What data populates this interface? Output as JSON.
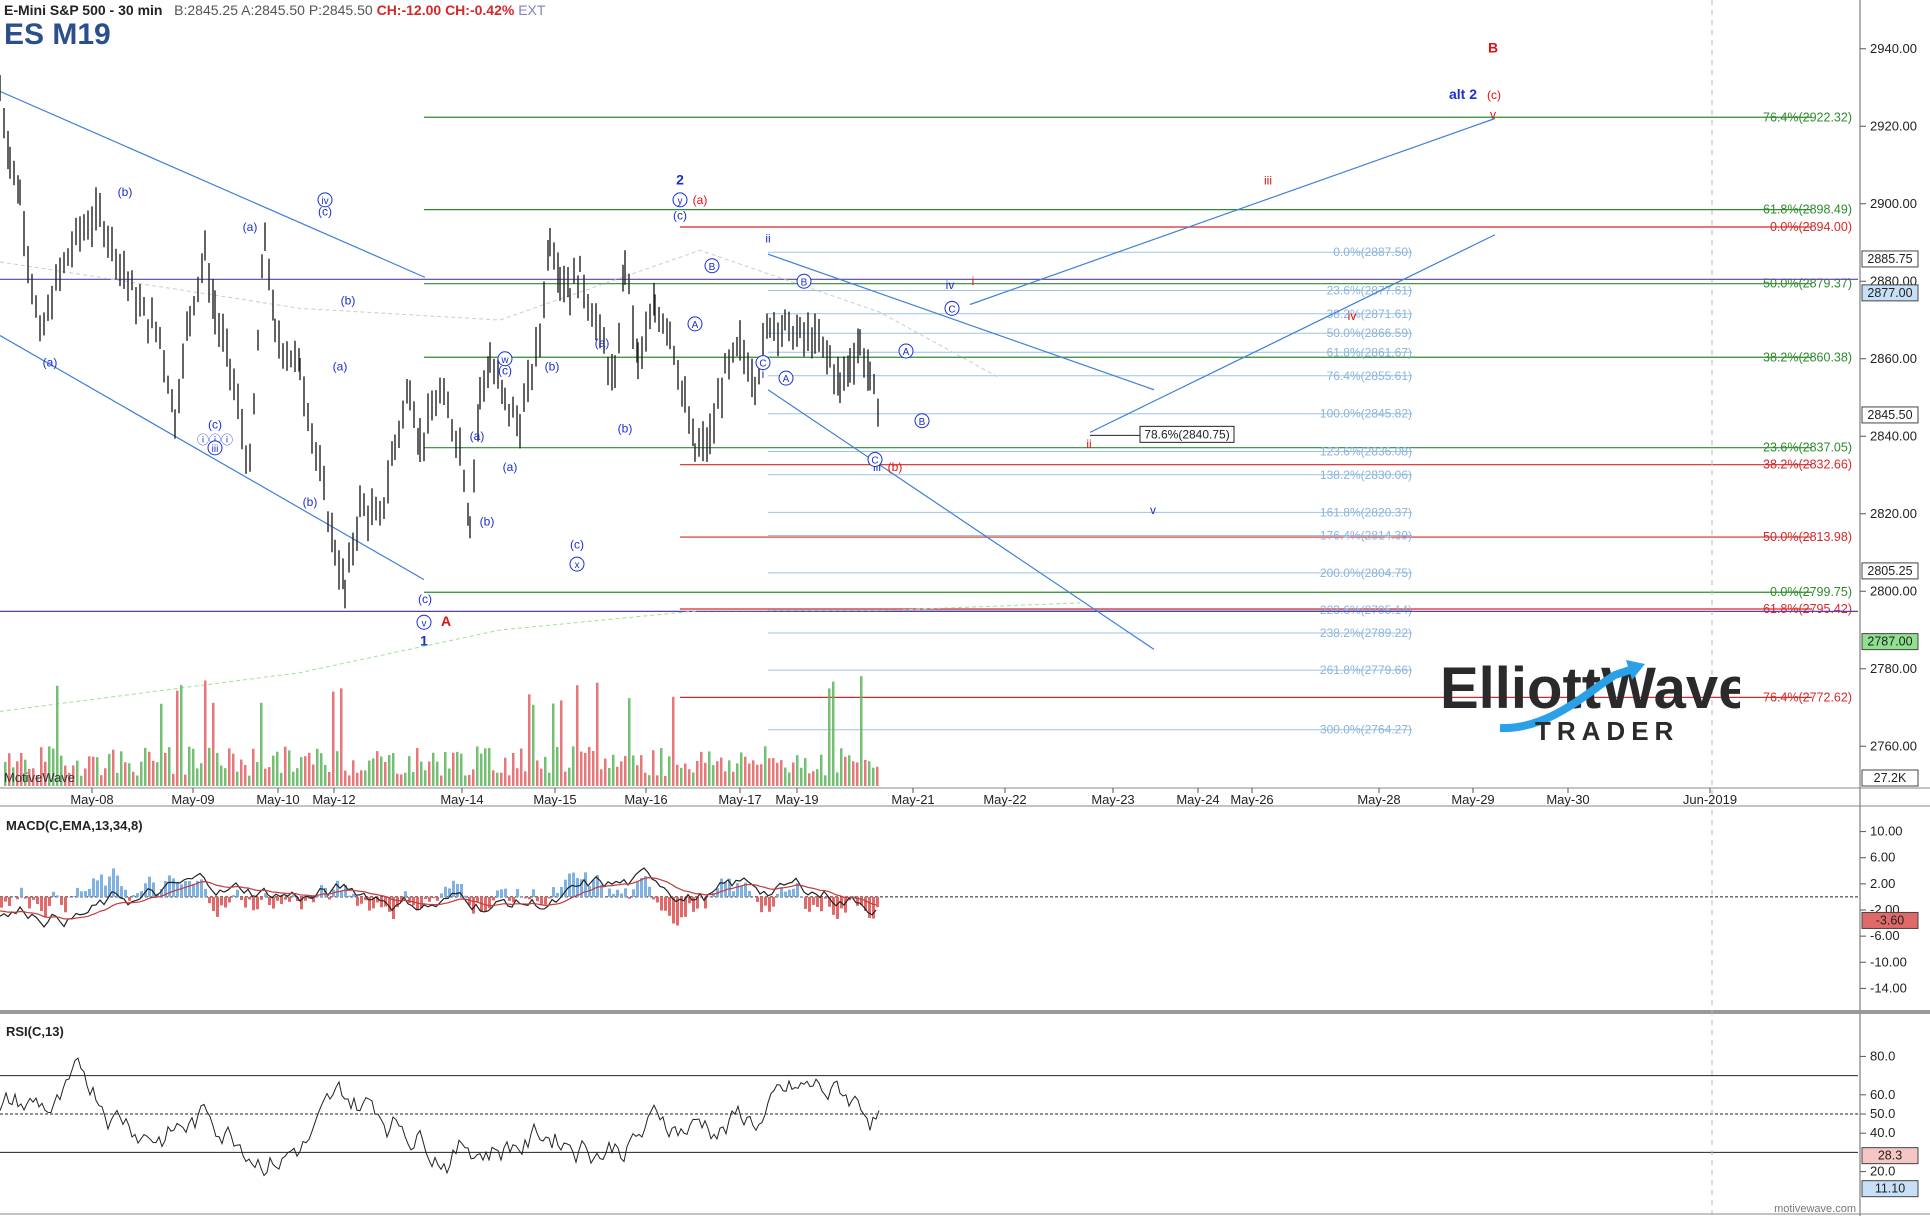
{
  "header": {
    "title": "E-Mini S&P 500 - 30 min",
    "bid": "B:2845.25",
    "ask": "A:2845.50",
    "last": "P:2845.50",
    "change": "CH:-12.00",
    "change_pct": "CH:-0.42%",
    "session": "EXT",
    "symbol": "ES M19"
  },
  "branding": {
    "watermark": "MotiveWave",
    "url": "motivewave.com",
    "logo_text": "ElliottWave",
    "logo_sub": "TRADER"
  },
  "colors": {
    "up": "#3aa03a",
    "down": "#d83a3a",
    "fib_green": "#2e8b2e",
    "fib_red": "#d62828",
    "fib_blue": "#9cc3e6",
    "trend": "#3f7fd9",
    "label_blue": "#1a2fd0",
    "label_red": "#e01010"
  },
  "chart_data": [
    {
      "type": "candlestick",
      "name": "price",
      "ylim": [
        2750,
        2950
      ],
      "yticks": [
        2760,
        2780,
        2800,
        2820,
        2840,
        2860,
        2880,
        2900,
        2920,
        2940
      ],
      "x_labels": [
        "May-08",
        "May-09",
        "May-10",
        "May-12",
        "May-14",
        "May-15",
        "May-16",
        "May-17",
        "May-19",
        "May-21",
        "May-22",
        "May-23",
        "May-24",
        "May-26",
        "May-28",
        "May-29",
        "May-30",
        "Jun-2019"
      ],
      "price_path": [
        [
          0,
          2929
        ],
        [
          10,
          2912
        ],
        [
          20,
          2902
        ],
        [
          40,
          2865
        ],
        [
          60,
          2882
        ],
        [
          80,
          2893
        ],
        [
          100,
          2897
        ],
        [
          120,
          2885
        ],
        [
          140,
          2873
        ],
        [
          160,
          2866
        ],
        [
          175,
          2845
        ],
        [
          190,
          2872
        ],
        [
          205,
          2887
        ],
        [
          215,
          2872
        ],
        [
          230,
          2858
        ],
        [
          250,
          2831
        ],
        [
          265,
          2893
        ],
        [
          275,
          2866
        ],
        [
          300,
          2858
        ],
        [
          320,
          2830
        ],
        [
          335,
          2811
        ],
        [
          345,
          2800
        ],
        [
          360,
          2822
        ],
        [
          380,
          2818
        ],
        [
          395,
          2838
        ],
        [
          410,
          2853
        ],
        [
          420,
          2838
        ],
        [
          440,
          2851
        ],
        [
          460,
          2838
        ],
        [
          470,
          2818
        ],
        [
          480,
          2851
        ],
        [
          490,
          2859
        ],
        [
          505,
          2849
        ],
        [
          520,
          2843
        ],
        [
          540,
          2866
        ],
        [
          550,
          2892
        ],
        [
          560,
          2882
        ],
        [
          570,
          2878
        ],
        [
          580,
          2882
        ],
        [
          600,
          2866
        ],
        [
          615,
          2853
        ],
        [
          625,
          2886
        ],
        [
          638,
          2859
        ],
        [
          655,
          2873
        ],
        [
          670,
          2868
        ],
        [
          685,
          2848
        ],
        [
          695,
          2836
        ],
        [
          710,
          2839
        ],
        [
          725,
          2856
        ],
        [
          740,
          2863
        ],
        [
          755,
          2855
        ],
        [
          770,
          2870
        ],
        [
          785,
          2868
        ],
        [
          800,
          2866
        ],
        [
          815,
          2865
        ],
        [
          830,
          2860
        ],
        [
          840,
          2853
        ],
        [
          850,
          2859
        ],
        [
          860,
          2864
        ],
        [
          870,
          2855
        ],
        [
          880,
          2845
        ]
      ],
      "price_marker": "2845.50",
      "right_markers": [
        {
          "value": 2885.75,
          "label": "2885.75",
          "bg": "#ffffff"
        },
        {
          "value": 2877.0,
          "label": "2877.00",
          "bg": "#c7e0f7"
        },
        {
          "value": 2845.5,
          "label": "2845.50",
          "bg": "#ffffff"
        },
        {
          "value": 2805.25,
          "label": "2805.25",
          "bg": "#ffffff"
        },
        {
          "value": 2787.0,
          "label": "2787.00",
          "bg": "#8fe08f"
        }
      ],
      "volume_label": "27.2K",
      "callout": "78.6%(2840.75)",
      "fib_levels_green": [
        {
          "value": 2922.32,
          "label": "76.4%(2922.32)"
        },
        {
          "value": 2898.49,
          "label": "61.8%(2898.49)"
        },
        {
          "value": 2879.37,
          "label": "50.0%(2879.37)"
        },
        {
          "value": 2860.38,
          "label": "38.2%(2860.38)"
        },
        {
          "value": 2837.05,
          "label": "23.6%(2837.05)"
        },
        {
          "value": 2799.75,
          "label": "0.0%(2799.75)"
        }
      ],
      "fib_levels_red": [
        {
          "value": 2894.0,
          "label": "0.0%(2894.00)"
        },
        {
          "value": 2832.66,
          "label": "38.2%(2832.66)"
        },
        {
          "value": 2813.98,
          "label": "50.0%(2813.98)"
        },
        {
          "value": 2795.42,
          "label": "61.8%(2795.42)"
        },
        {
          "value": 2772.62,
          "label": "76.4%(2772.62)"
        }
      ],
      "fib_levels_blue": [
        {
          "value": 2887.5,
          "label": "0.0%(2887.50)"
        },
        {
          "value": 2877.61,
          "label": "23.6%(2877.61)"
        },
        {
          "value": 2871.61,
          "label": "38.2%(2871.61)"
        },
        {
          "value": 2866.59,
          "label": "50.0%(2866.59)"
        },
        {
          "value": 2861.67,
          "label": "61.8%(2861.67)"
        },
        {
          "value": 2855.61,
          "label": "76.4%(2855.61)"
        },
        {
          "value": 2845.82,
          "label": "100.0%(2845.82)"
        },
        {
          "value": 2836.08,
          "label": "123.6%(2836.08)"
        },
        {
          "value": 2830.06,
          "label": "138.2%(2830.06)"
        },
        {
          "value": 2820.37,
          "label": "161.8%(2820.37)"
        },
        {
          "value": 2814.39,
          "label": "176.4%(2814.39)"
        },
        {
          "value": 2804.75,
          "label": "200.0%(2804.75)"
        },
        {
          "value": 2795.14,
          "label": "223.6%(2795.14)"
        },
        {
          "value": 2789.22,
          "label": "238.2%(2789.22)"
        },
        {
          "value": 2779.66,
          "label": "261.8%(2779.66)"
        },
        {
          "value": 2764.27,
          "label": "300.0%(2764.27)"
        }
      ],
      "purple_levels": [
        2880.5,
        2794.8
      ],
      "wave_labels": [
        {
          "t": "(b)",
          "x": 125,
          "p": 2902,
          "c": "blue"
        },
        {
          "t": "(a)",
          "x": 50,
          "p": 2858,
          "c": "blue"
        },
        {
          "t": "(c)",
          "x": 215,
          "p": 2842,
          "c": "blue"
        },
        {
          "t": "ⓘⓘⓘ",
          "x": 215,
          "p": 2838,
          "c": "blue",
          "circled": "iii"
        },
        {
          "t": "(a)",
          "x": 250,
          "p": 2893,
          "c": "blue"
        },
        {
          "t": "(b)",
          "x": 310,
          "p": 2822,
          "c": "blue"
        },
        {
          "t": "(c)",
          "x": 325,
          "p": 2897,
          "c": "blue"
        },
        {
          "t": "(b)",
          "x": 348,
          "p": 2874,
          "c": "blue"
        },
        {
          "t": "(a)",
          "x": 340,
          "p": 2857,
          "c": "blue"
        },
        {
          "t": "(c)",
          "x": 425,
          "p": 2797,
          "c": "blue"
        },
        {
          "t": "(a)",
          "x": 477,
          "p": 2839,
          "c": "blue"
        },
        {
          "t": "(a)",
          "x": 510,
          "p": 2831,
          "c": "blue"
        },
        {
          "t": "(b)",
          "x": 487,
          "p": 2817,
          "c": "blue"
        },
        {
          "t": "(c)",
          "x": 505,
          "p": 2856,
          "c": "blue"
        },
        {
          "t": "(b)",
          "x": 552,
          "p": 2857,
          "c": "blue"
        },
        {
          "t": "(c)",
          "x": 577,
          "p": 2811,
          "c": "blue"
        },
        {
          "t": "(a)",
          "x": 602,
          "p": 2863,
          "c": "blue"
        },
        {
          "t": "(b)",
          "x": 625,
          "p": 2841,
          "c": "blue"
        },
        {
          "t": "(c)",
          "x": 680,
          "p": 2896,
          "c": "blue"
        },
        {
          "t": "i",
          "x": 763,
          "p": 2855,
          "c": "blue"
        },
        {
          "t": "ii",
          "x": 768,
          "p": 2890,
          "c": "blue"
        },
        {
          "t": "iii",
          "x": 877,
          "p": 2831,
          "c": "blue"
        },
        {
          "t": "iv",
          "x": 950,
          "p": 2878,
          "c": "blue"
        },
        {
          "t": "v",
          "x": 1153,
          "p": 2820,
          "c": "blue"
        },
        {
          "t": "alt 2",
          "x": 1463,
          "p": 2927,
          "c": "blue",
          "bold": true
        },
        {
          "t": "1",
          "x": 424,
          "p": 2786,
          "c": "blue",
          "bold": true
        },
        {
          "t": "2",
          "x": 680,
          "p": 2905,
          "c": "blue",
          "bold": true
        },
        {
          "t": "A",
          "x": 446,
          "p": 2791,
          "c": "red",
          "bold": true
        },
        {
          "t": "B",
          "x": 1493,
          "p": 2939,
          "c": "red",
          "bold": true
        },
        {
          "t": "(a)",
          "x": 700,
          "p": 2900,
          "c": "red"
        },
        {
          "t": "(b)",
          "x": 895,
          "p": 2831,
          "c": "red"
        },
        {
          "t": "(c)",
          "x": 1494,
          "p": 2927,
          "c": "red"
        },
        {
          "t": "i",
          "x": 973,
          "p": 2879,
          "c": "red"
        },
        {
          "t": "ii",
          "x": 1089,
          "p": 2837,
          "c": "red"
        },
        {
          "t": "iii",
          "x": 1268,
          "p": 2905,
          "c": "red"
        },
        {
          "t": "iv",
          "x": 1352,
          "p": 2870,
          "c": "red"
        },
        {
          "t": "v",
          "x": 1493,
          "p": 2922,
          "c": "red"
        }
      ],
      "circled_labels": [
        {
          "t": "iv",
          "x": 325,
          "p": 2901
        },
        {
          "t": "iii",
          "x": 215,
          "p": 2837
        },
        {
          "t": "v",
          "x": 424,
          "p": 2792
        },
        {
          "t": "w",
          "x": 505,
          "p": 2860
        },
        {
          "t": "x",
          "x": 577,
          "p": 2807
        },
        {
          "t": "y",
          "x": 680,
          "p": 2901
        },
        {
          "t": "A",
          "x": 695,
          "p": 2869
        },
        {
          "t": "B",
          "x": 712,
          "p": 2884
        },
        {
          "t": "C",
          "x": 763,
          "p": 2859
        },
        {
          "t": "A",
          "x": 786,
          "p": 2855
        },
        {
          "t": "B",
          "x": 804,
          "p": 2880
        },
        {
          "t": "C",
          "x": 875,
          "p": 2834
        },
        {
          "t": "C",
          "x": 952,
          "p": 2873
        },
        {
          "t": "A",
          "x": 906,
          "p": 2862
        },
        {
          "t": "B",
          "x": 922,
          "p": 2844
        }
      ]
    },
    {
      "type": "line",
      "name": "MACD(C,EMA,13,34,8)",
      "title": "MACD(C,EMA,13,34,8)",
      "ylim": [
        -17,
        13
      ],
      "yticks": [
        10,
        6,
        2,
        -2,
        -6,
        -10,
        -14
      ],
      "ytick_labels": [
        "10.00",
        "6.00",
        "2.00",
        "-2.00",
        "-6.00",
        "-10.00",
        "-14.00"
      ],
      "marker": "-3.60"
    },
    {
      "type": "line",
      "name": "RSI(C,13)",
      "title": "RSI(C,13)",
      "ylim": [
        0,
        100
      ],
      "yticks": [
        80,
        60,
        50,
        40,
        20
      ],
      "ytick_labels": [
        "80.0",
        "60.0",
        "50.0",
        "40.0",
        "20.0"
      ],
      "levels": [
        70,
        50,
        30
      ],
      "markers": [
        "28.3",
        "11.10"
      ]
    }
  ]
}
